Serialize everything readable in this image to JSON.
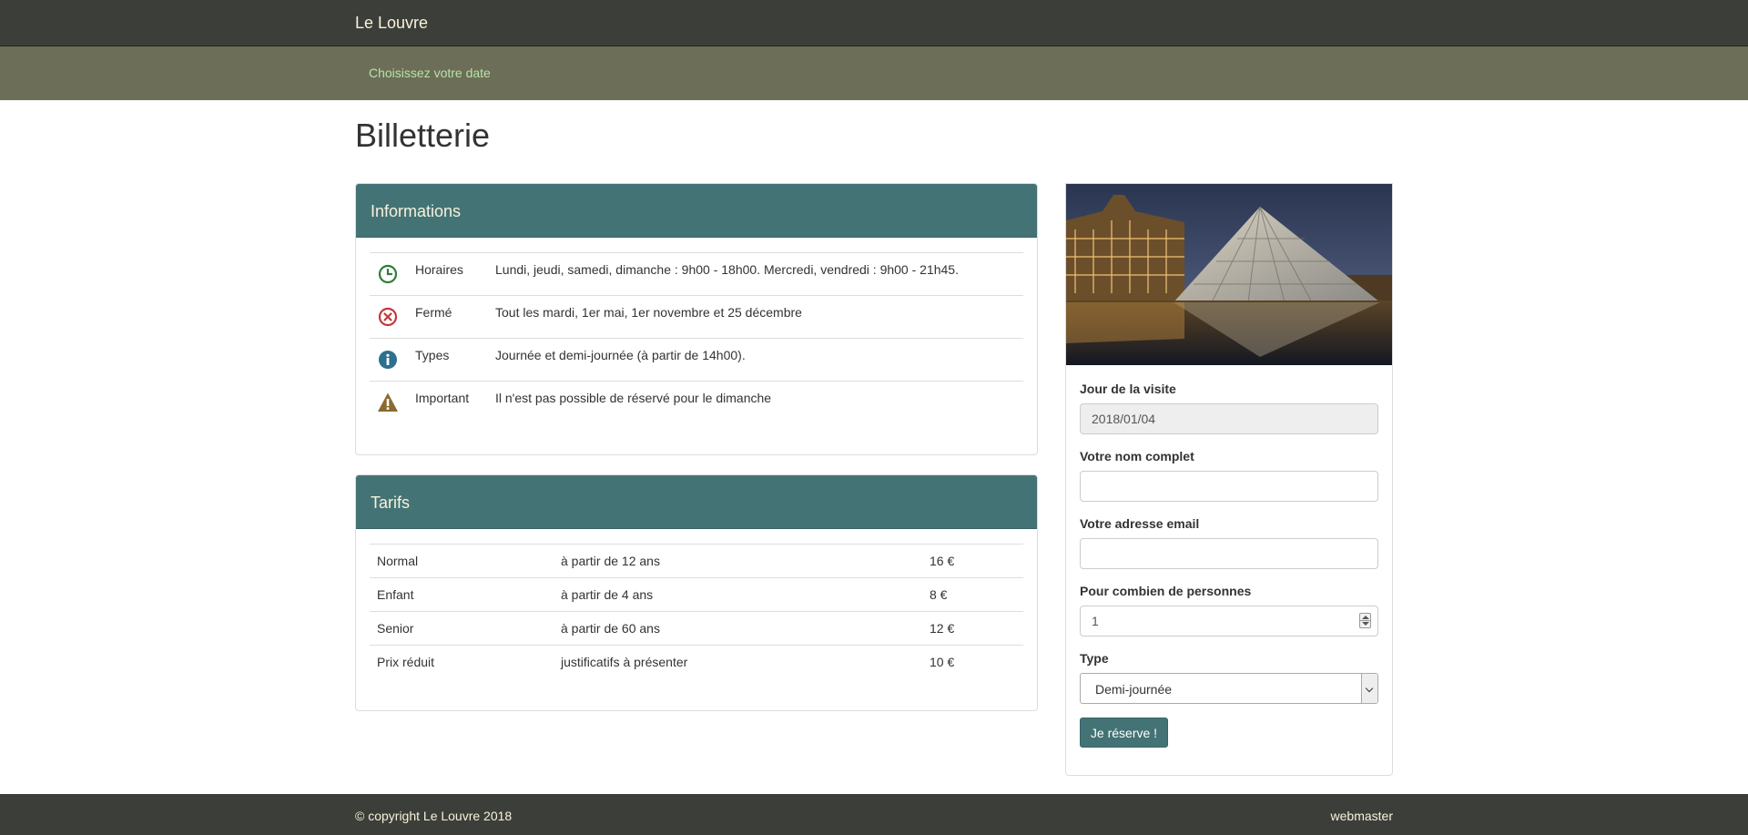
{
  "navbar": {
    "brand": "Le Louvre"
  },
  "subnav": {
    "link": "Choisissez votre date"
  },
  "page": {
    "title": "Billetterie"
  },
  "informations": {
    "title": "Informations",
    "rows": [
      {
        "icon": "clock-icon",
        "label": "Horaires",
        "value": "Lundi, jeudi, samedi, dimanche : 9h00 - 18h00. Mercredi, vendredi : 9h00 - 21h45."
      },
      {
        "icon": "closed-circle-x-icon",
        "label": "Fermé",
        "value": "Tout les mardi, 1er mai, 1er novembre et 25 décembre"
      },
      {
        "icon": "info-icon",
        "label": "Types",
        "value": "Journée et demi-journée (à partir de 14h00)."
      },
      {
        "icon": "warning-triangle-icon",
        "label": "Important",
        "value": "Il n'est pas possible de réservé pour le dimanche"
      }
    ]
  },
  "tarifs": {
    "title": "Tarifs",
    "rows": [
      {
        "name": "Normal",
        "condition": "à partir de 12 ans",
        "price": "16 €"
      },
      {
        "name": "Enfant",
        "condition": "à partir de 4 ans",
        "price": "8 €"
      },
      {
        "name": "Senior",
        "condition": "à partir de 60 ans",
        "price": "12 €"
      },
      {
        "name": "Prix réduit",
        "condition": "justificatifs à présenter",
        "price": "10 €"
      }
    ]
  },
  "form": {
    "date_label": "Jour de la visite",
    "date_value": "2018/01/04",
    "name_label": "Votre nom complet",
    "name_value": "",
    "email_label": "Votre adresse email",
    "email_value": "",
    "persons_label": "Pour combien de personnes",
    "persons_value": "1",
    "type_label": "Type",
    "type_value": "Demi-journée",
    "submit": "Je réserve !"
  },
  "colors": {
    "navbar": "#3c3f39",
    "subnav": "#6c6e58",
    "accent": "#447375",
    "brand_text": "#f7f2dc",
    "subnav_link": "#b8e2a8",
    "clock": "#2e7d3a",
    "closed": "#c0393b",
    "info": "#2d6f8e",
    "warning": "#8a6a2e"
  },
  "footer": {
    "copyright": "© copyright Le Louvre 2018",
    "webmaster": "webmaster"
  }
}
